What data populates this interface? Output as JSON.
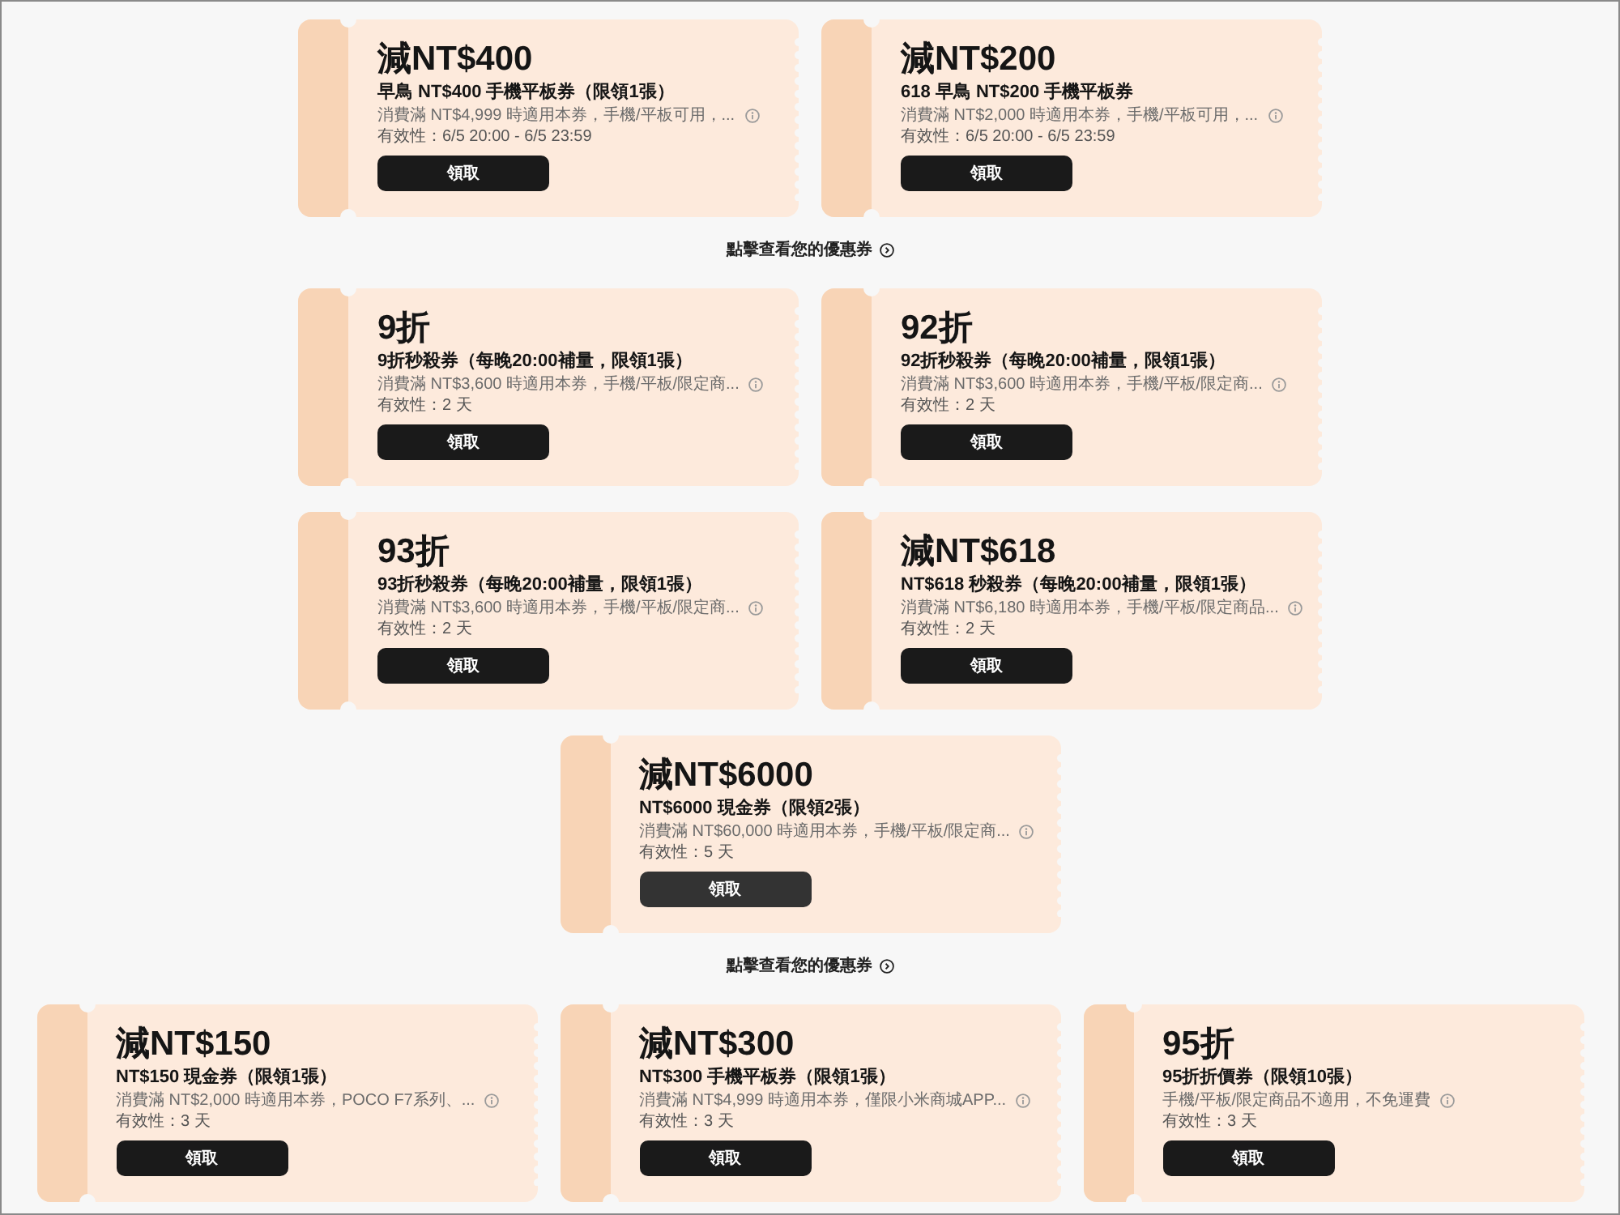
{
  "sections": [
    {
      "coupons": [
        {
          "title": "減NT$400",
          "name": "早鳥 NT$400 手機平板券（限領1張）",
          "terms": "消費滿 NT$4,999 時適用本券，手機/平板可用，...",
          "validity": "有效性：6/5 20:00 - 6/5 23:59",
          "button": {
            "label": "領取",
            "hovered": false
          }
        },
        {
          "title": "減NT$200",
          "name": "618 早鳥 NT$200 手機平板券",
          "terms": "消費滿 NT$2,000 時適用本券，手機/平板可用，...",
          "validity": "有效性：6/5 20:00 - 6/5 23:59",
          "button": {
            "label": "領取",
            "hovered": false
          }
        }
      ],
      "link": {
        "label": "點擊查看您的優惠券"
      }
    },
    {
      "coupons": [
        {
          "title": "9折",
          "name": "9折秒殺券（每晚20:00補量，限領1張）",
          "terms": "消費滿 NT$3,600 時適用本券，手機/平板/限定商...",
          "validity": "有效性：2 天",
          "button": {
            "label": "領取",
            "hovered": false
          }
        },
        {
          "title": "92折",
          "name": "92折秒殺券（每晚20:00補量，限領1張）",
          "terms": "消費滿 NT$3,600 時適用本券，手機/平板/限定商...",
          "validity": "有效性：2 天",
          "button": {
            "label": "領取",
            "hovered": false
          }
        },
        {
          "title": "93折",
          "name": "93折秒殺券（每晚20:00補量，限領1張）",
          "terms": "消費滿 NT$3,600 時適用本券，手機/平板/限定商...",
          "validity": "有效性：2 天",
          "button": {
            "label": "領取",
            "hovered": false
          }
        },
        {
          "title": "減NT$618",
          "name": "NT$618 秒殺券（每晚20:00補量，限領1張）",
          "terms": "消費滿 NT$6,180 時適用本券，手機/平板/限定商品...",
          "validity": "有效性：2 天",
          "button": {
            "label": "領取",
            "hovered": false
          }
        },
        {
          "title": "減NT$6000",
          "name": "NT$6000 現金券（限領2張）",
          "terms": "消費滿 NT$60,000 時適用本券，手機/平板/限定商...",
          "validity": "有效性：5 天",
          "button": {
            "label": "領取",
            "hovered": true
          }
        }
      ],
      "link": {
        "label": "點擊查看您的優惠券"
      }
    },
    {
      "coupons": [
        {
          "title": "減NT$150",
          "name": "NT$150 現金券（限領1張）",
          "terms": "消費滿 NT$2,000 時適用本券，POCO F7系列、...",
          "validity": "有效性：3 天",
          "button": {
            "label": "領取",
            "hovered": false
          }
        },
        {
          "title": "減NT$300",
          "name": "NT$300 手機平板券（限領1張）",
          "terms": "消費滿 NT$4,999 時適用本券，僅限小米商城APP...",
          "validity": "有效性：3 天",
          "button": {
            "label": "領取",
            "hovered": false
          }
        },
        {
          "title": "95折",
          "name": "95折折價券（限領10張）",
          "terms": "手機/平板/限定商品不適用，不免運費",
          "validity": "有效性：3 天",
          "button": {
            "label": "領取",
            "hovered": false
          }
        }
      ]
    }
  ]
}
